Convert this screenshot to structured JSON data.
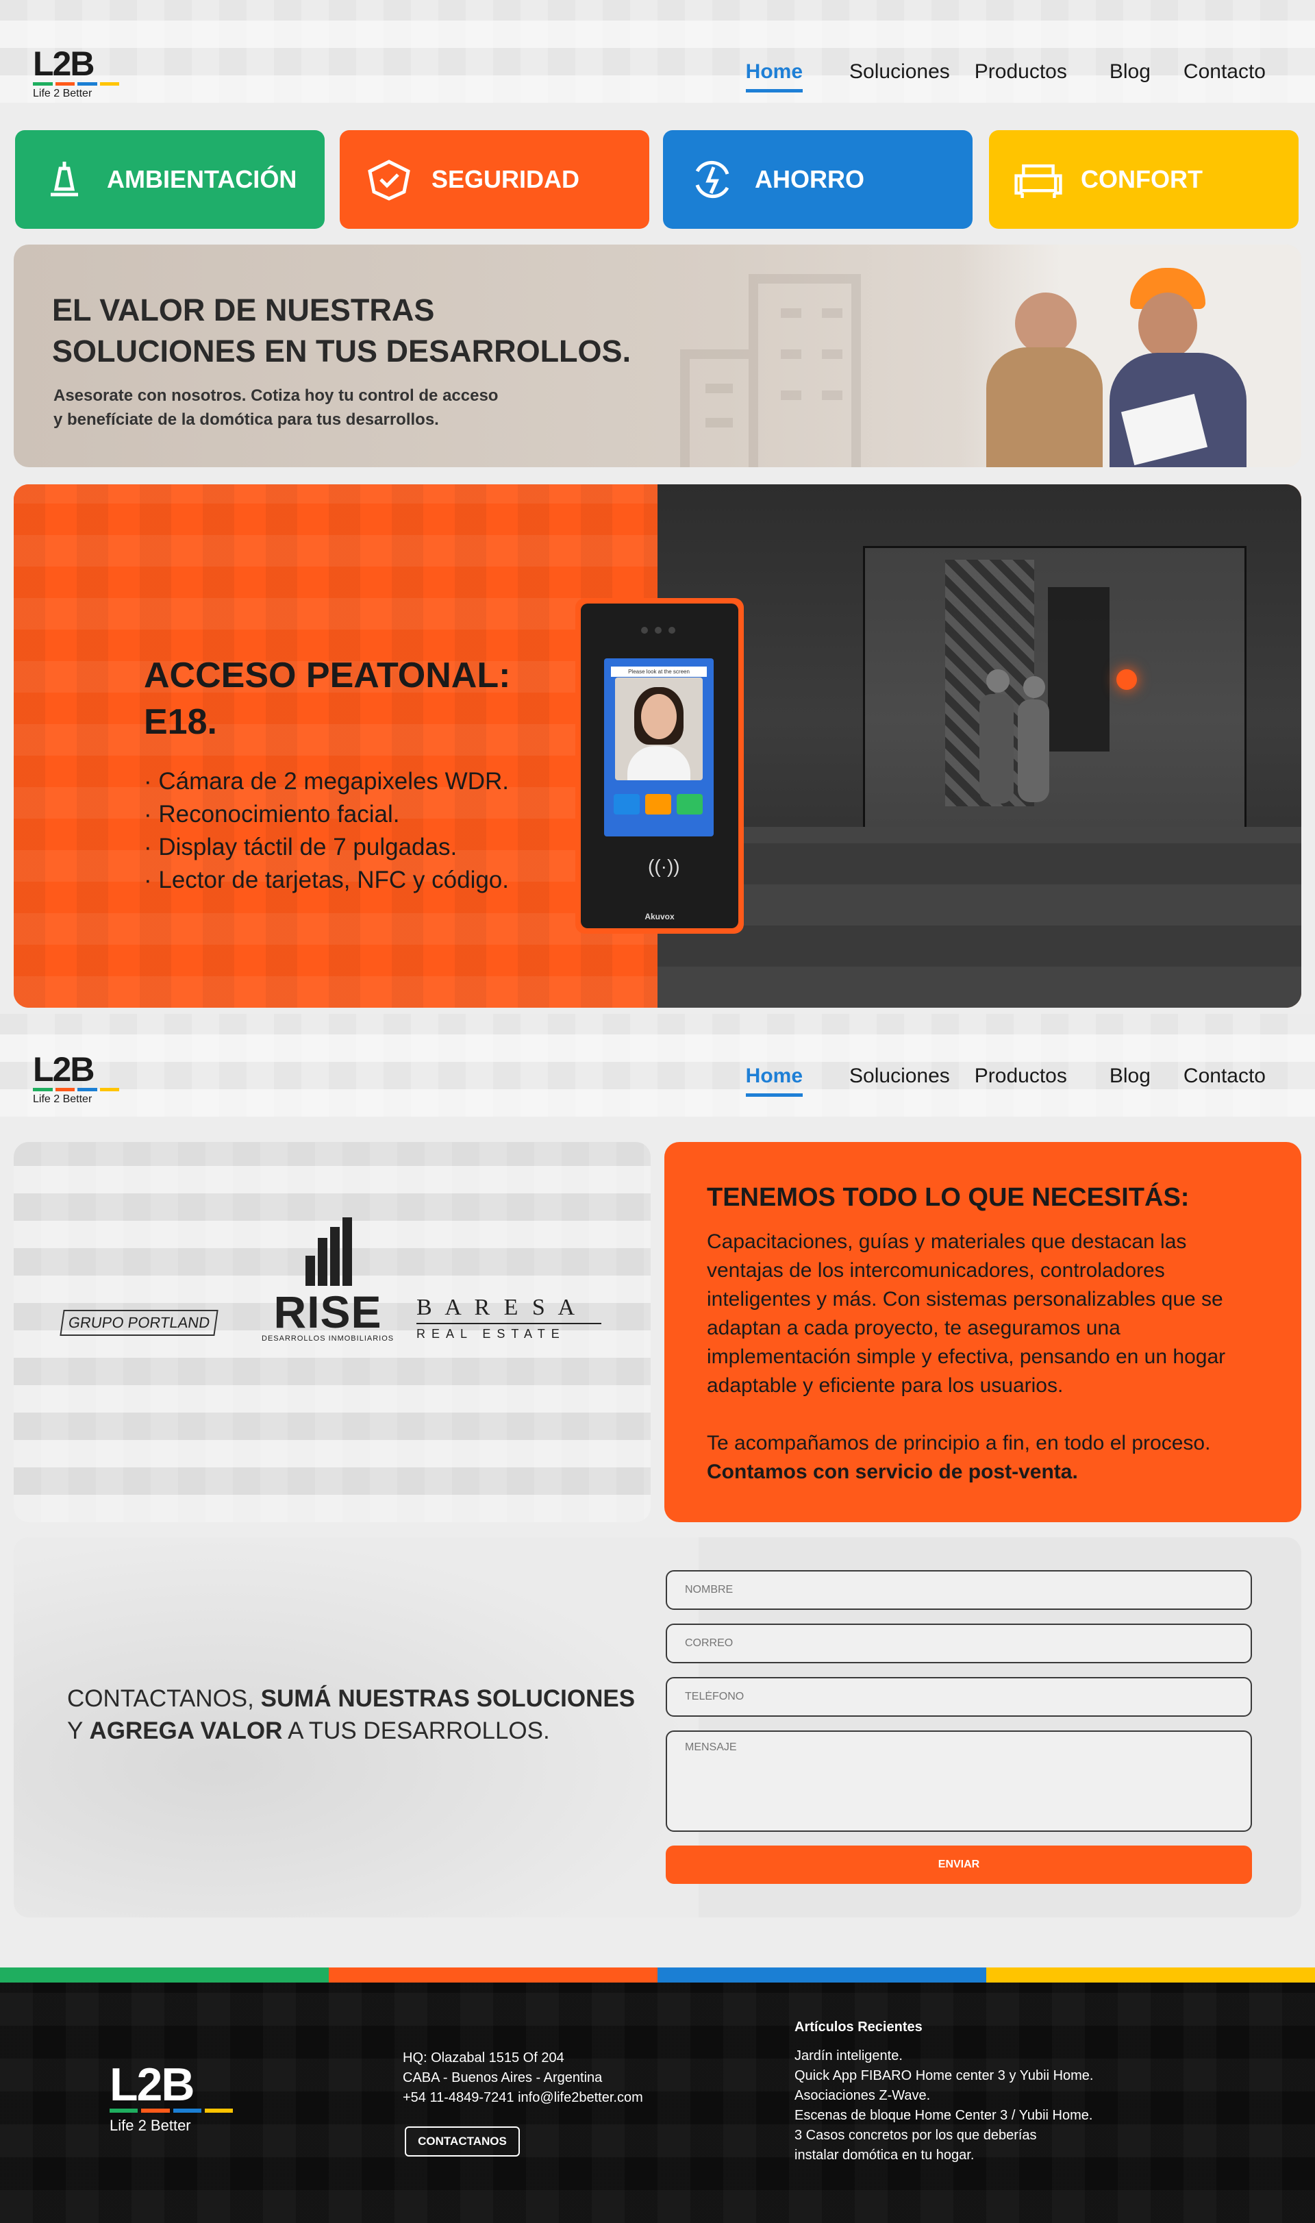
{
  "brand": {
    "logo_text": "L2B",
    "tagline": "Life 2 Better",
    "colors": [
      "#1fae5f",
      "#ff5a1a",
      "#1b7fd4",
      "#ffc400"
    ]
  },
  "nav": {
    "items": [
      {
        "label": "Home",
        "active": true
      },
      {
        "label": "Soluciones"
      },
      {
        "label": "Productos"
      },
      {
        "label": "Blog"
      },
      {
        "label": "Contacto"
      }
    ]
  },
  "categories": [
    {
      "label": "AMBIENTACIÓN",
      "color": "#1fae6a",
      "icon": "bell-lamp-icon"
    },
    {
      "label": "SEGURIDAD",
      "color": "#ff5a1a",
      "icon": "shield-check-icon"
    },
    {
      "label": "AHORRO",
      "color": "#1b7fd4",
      "icon": "energy-cycle-icon"
    },
    {
      "label": "CONFORT",
      "color": "#ffc400",
      "icon": "sofa-icon"
    }
  ],
  "hero": {
    "title_line1": "EL VALOR DE NUESTRAS",
    "title_line2": "SOLUCIONES EN TUS DESARROLLOS.",
    "text_line1": "Asesorate con nosotros. Cotiza hoy tu control de acceso",
    "text_line2": "y benefíciate de la domótica para tus desarrollos."
  },
  "product": {
    "title_line1": "ACCESO PEATONAL:",
    "title_line2": "E18.",
    "features": [
      "· Cámara de 2 megapixeles WDR.",
      "· Reconocimiento facial.",
      "· Display táctil de 7 pulgadas.",
      "· Lector de tarjetas, NFC y código."
    ],
    "device_brand": "Akuvox",
    "screen_prompt": "Please look at the screen",
    "accent": "#ff5a1a"
  },
  "clients": {
    "logos": [
      "GRUPO PORTLAND",
      "RISE",
      "DESARROLLOS INMOBILIARIOS",
      "B A R E S A",
      "REAL ESTATE"
    ]
  },
  "needs": {
    "title": "TENEMOS TODO LO QUE NECESITÁS:",
    "body": "Capacitaciones, guías y materiales que destacan las ventajas de los intercomunicadores, controladores inteligentes y más. Con sistemas personalizables que se adaptan a cada proyecto, te aseguramos una implementación simple y efectiva, pensando en un hogar adaptable y eficiente para los usuarios.",
    "follow_up": "Te acompañamos de principio a fin, en todo el proceso.",
    "follow_up_bold": "Contamos con servicio de post-venta."
  },
  "contact": {
    "cta_part1": "CONTACTANOS, ",
    "cta_bold1": "SUMÁ NUESTRAS SOLUCIONES",
    "cta_part2": "Y ",
    "cta_bold2": "AGREGA VALOR",
    "cta_part3": " A TUS DESARROLLOS.",
    "fields": {
      "name": "NOMBRE",
      "email": "CORREO",
      "phone": "TELÉFONO",
      "message": "MENSAJE"
    },
    "submit_label": "ENVIAR"
  },
  "footer": {
    "address_line1": "HQ: Olazabal 1515 Of 204",
    "address_line2": "CABA - Buenos Aires - Argentina",
    "address_line3": "+54 11-4849-7241 info@life2better.com",
    "contact_button": "CONTACTANOS",
    "posts_title": "Artículos Recientes",
    "posts": [
      "Jardín inteligente.",
      "Quick App FIBARO Home center 3 y Yubii Home.",
      "Asociaciones Z-Wave.",
      "Escenas de bloque Home Center 3 / Yubii Home.",
      "3 Casos concretos por los que deberías",
      "instalar domótica en tu hogar."
    ]
  }
}
